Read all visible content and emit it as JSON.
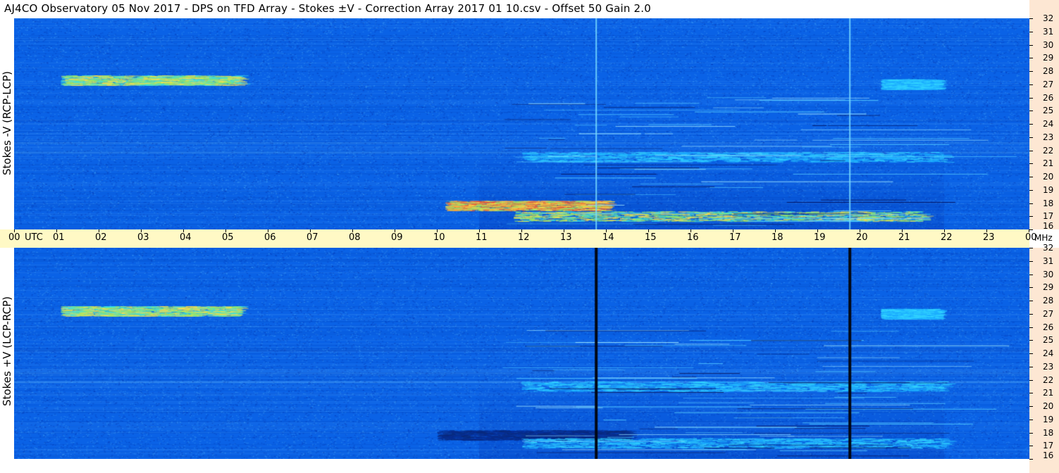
{
  "title": "AJ4CO Observatory  05 Nov 2017  -  DPS on TFD Array  -  Stokes ±V  -  Correction Array 2017 01 10.csv  -  Offset 50  Gain 2.0",
  "time_axis": {
    "labels": [
      "00",
      "01",
      "02",
      "03",
      "04",
      "05",
      "06",
      "07",
      "08",
      "09",
      "10",
      "11",
      "12",
      "13",
      "14",
      "15",
      "16",
      "17",
      "18",
      "19",
      "20",
      "21",
      "22",
      "23",
      "00"
    ],
    "unit": "UTC",
    "freq_unit": "MHz"
  },
  "colors": {
    "background": "#0a62e6",
    "freq_axis_bg": "#fde7d3",
    "time_axis_bg": "#fff9c5"
  },
  "chart_data": [
    {
      "type": "heatmap",
      "title": "",
      "ylabel": "Stokes -V (RCP-LCP)",
      "xlabel": "UTC",
      "x_range_hours": [
        0,
        24
      ],
      "y_range_mhz": [
        16,
        32
      ],
      "yticks": [
        32,
        31,
        30,
        29,
        28,
        27,
        26,
        25,
        24,
        23,
        22,
        21,
        20,
        19,
        18,
        17,
        16
      ],
      "vertical_lines": [
        {
          "hour": 13.77,
          "style": "bright"
        },
        {
          "hour": 19.77,
          "style": "bright"
        }
      ],
      "features": [
        {
          "t_start": 1.1,
          "t_end": 5.3,
          "mhz": 27.3,
          "level": "high"
        },
        {
          "t_start": 10.2,
          "t_end": 14.0,
          "mhz": 17.8,
          "level": "very_high"
        },
        {
          "t_start": 11.8,
          "t_end": 21.5,
          "mhz": 17.0,
          "level": "high"
        },
        {
          "t_start": 12.0,
          "t_end": 22.0,
          "mhz": 21.5,
          "level": "medium"
        },
        {
          "t_start": 20.5,
          "t_end": 21.8,
          "mhz": 27.0,
          "level": "medium"
        }
      ]
    },
    {
      "type": "heatmap",
      "title": "",
      "ylabel": "Stokes +V (LCP-RCP)",
      "xlabel": "UTC",
      "x_range_hours": [
        0,
        24
      ],
      "y_range_mhz": [
        16,
        32
      ],
      "yticks": [
        32,
        31,
        30,
        29,
        28,
        27,
        26,
        25,
        24,
        23,
        22,
        21,
        20,
        19,
        18,
        17,
        16
      ],
      "vertical_lines": [
        {
          "hour": 13.77,
          "style": "dark"
        },
        {
          "hour": 19.77,
          "style": "dark"
        }
      ],
      "features": [
        {
          "t_start": 1.1,
          "t_end": 5.3,
          "mhz": 27.2,
          "level": "high"
        },
        {
          "t_start": 10.0,
          "t_end": 14.5,
          "mhz": 17.8,
          "level": "low"
        },
        {
          "t_start": 12.0,
          "t_end": 22.0,
          "mhz": 17.2,
          "level": "medium"
        },
        {
          "t_start": 12.0,
          "t_end": 22.0,
          "mhz": 21.5,
          "level": "medium"
        },
        {
          "t_start": 20.5,
          "t_end": 21.8,
          "mhz": 27.0,
          "level": "medium"
        }
      ]
    }
  ]
}
